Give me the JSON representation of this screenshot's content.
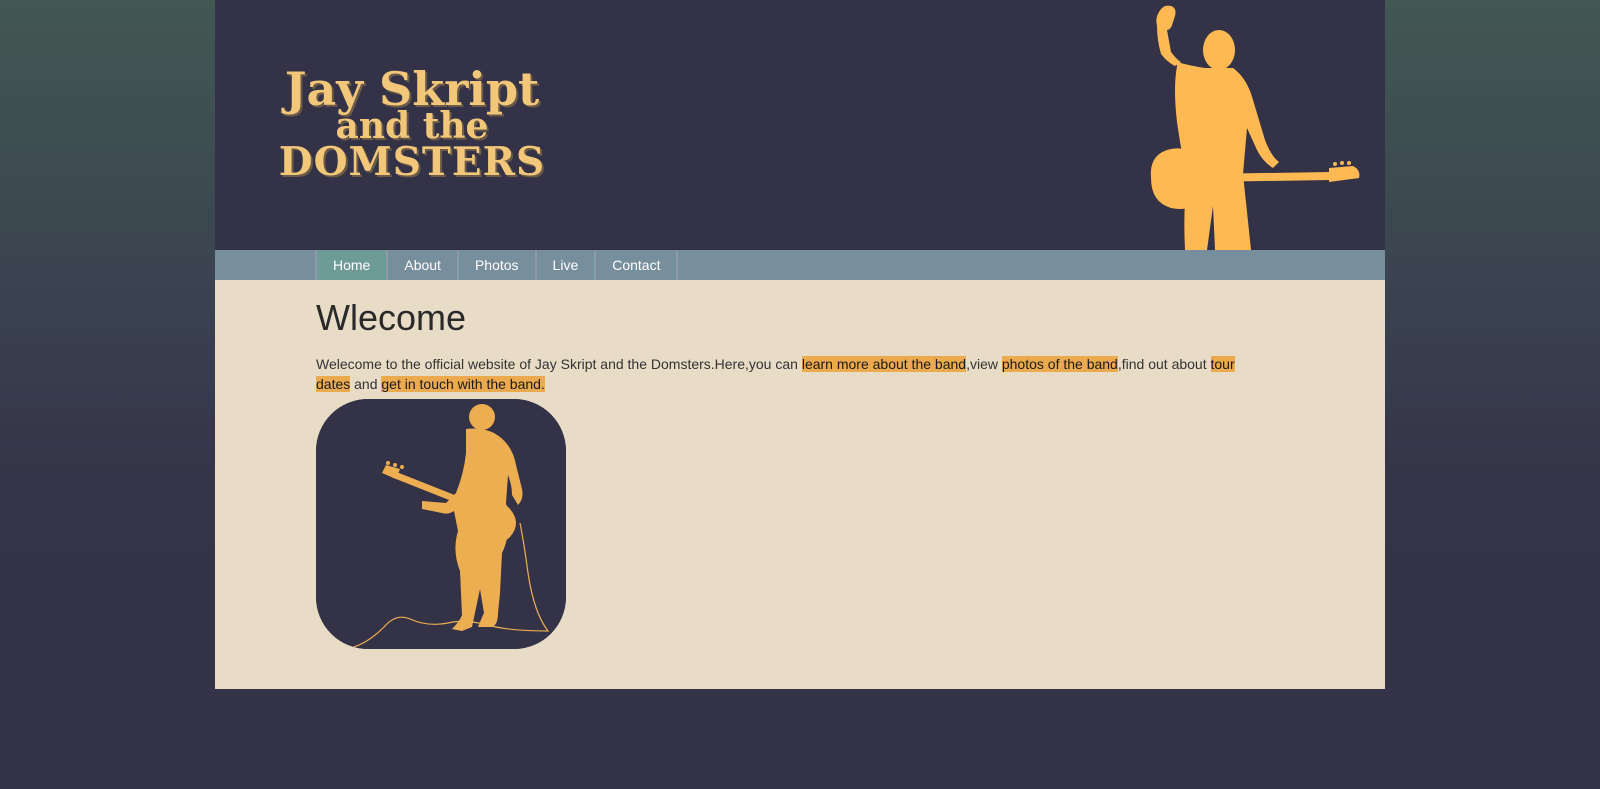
{
  "header": {
    "logo_line1": "Jay Skript",
    "logo_line2": "and the",
    "logo_line3": "DOMSTERS"
  },
  "nav": {
    "items": [
      "Home",
      "About",
      "Photos",
      "Live",
      "Contact"
    ],
    "active": "Home"
  },
  "main": {
    "title": "Wlecome",
    "intro": {
      "text1": "Welecome to the official website of Jay Skript and the Domsters.Here,you can ",
      "link1": "learn more about the band",
      "text2": ",view ",
      "link2": "photos of the band",
      "text3": ",find out about ",
      "link3": "tour dates",
      "text4": " and ",
      "link4": "get in touch with the band.",
      "text5": ""
    }
  },
  "colors": {
    "header_bg": "#343246",
    "accent": "#ecaa4f",
    "logo": "#f2c77a",
    "nav_bg": "#778e9d",
    "nav_active": "#6f9b97",
    "content_bg": "#e8dcc7"
  },
  "icons": [
    "guitarist-hero-silhouette",
    "guitarist-photo"
  ]
}
